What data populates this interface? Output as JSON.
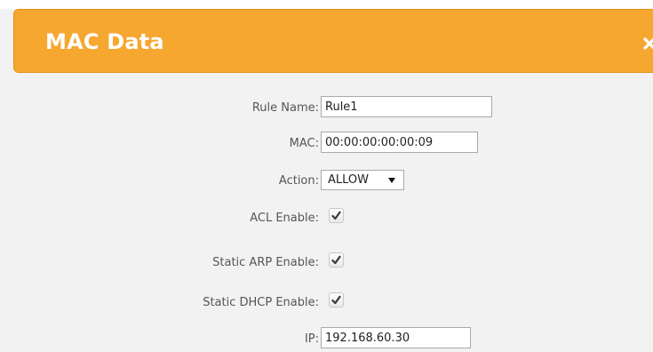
{
  "dialog": {
    "title": "MAC Data",
    "close_icon": "close-icon"
  },
  "form": {
    "rule_name": {
      "label": "Rule Name:",
      "value": "Rule1"
    },
    "mac": {
      "label": "MAC:",
      "value": "00:00:00:00:00:09"
    },
    "action": {
      "label": "Action:",
      "selected": "ALLOW"
    },
    "acl_enable": {
      "label": "ACL Enable:",
      "checked": true
    },
    "static_arp_enable": {
      "label": "Static ARP Enable:",
      "checked": true
    },
    "static_dhcp_enable": {
      "label": "Static DHCP Enable:",
      "checked": true
    },
    "ip": {
      "label": "IP:",
      "value": "192.168.60.30"
    }
  },
  "colors": {
    "header_bg": "#f6a730",
    "header_text": "#ffffff",
    "body_bg": "#f2f2f2",
    "label_text": "#555555"
  }
}
